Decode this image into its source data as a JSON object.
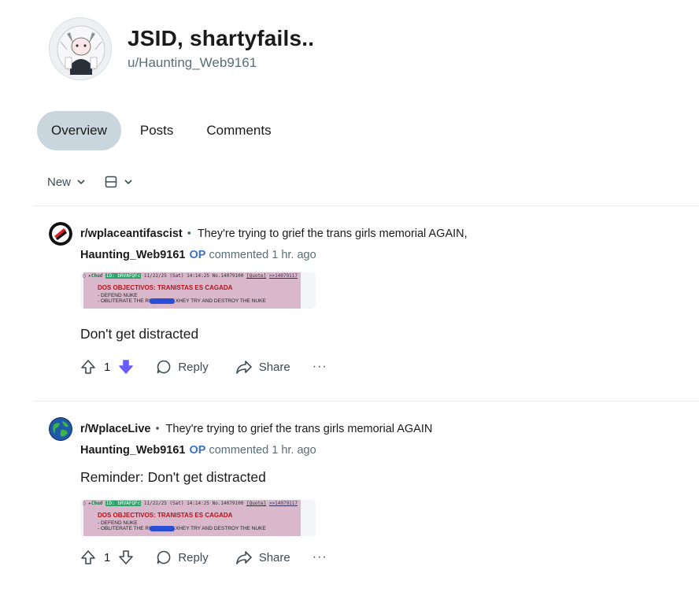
{
  "profile": {
    "display_name": "JSID, shartyfails..",
    "username": "u/Haunting_Web9161"
  },
  "tabs": [
    {
      "label": "Overview",
      "active": true
    },
    {
      "label": "Posts",
      "active": false
    },
    {
      "label": "Comments",
      "active": false
    }
  ],
  "sort": {
    "label": "New"
  },
  "comments": [
    {
      "subreddit": "r/wplaceantifascist",
      "post_title": "They're trying to grief the trans girls memorial AGAIN,",
      "author": "Haunting_Web9161",
      "op_badge": "OP",
      "meta": "commented 1 hr. ago",
      "text": "Don't get distracted",
      "score": "1",
      "reply_label": "Reply",
      "share_label": "Share",
      "more_label": "···",
      "downvoted": true
    },
    {
      "subreddit": "r/WplaceLive",
      "post_title": "They're trying to grief the trans girls memorial AGAIN",
      "author": "Haunting_Web9161",
      "op_badge": "OP",
      "meta": "commented 1 hr. ago",
      "text": "Reminder: Don't get distracted",
      "score": "1",
      "reply_label": "Reply",
      "share_label": "Share",
      "more_label": "···",
      "downvoted": false
    }
  ],
  "image_text": {
    "header_name": "Chud",
    "header_id": "ID: bRVAFQFc",
    "header_date": "11/22/25 (Sat) 14:14:25 No.14079100",
    "header_quote": "[Quote]",
    "header_reply": ">>14079117",
    "line1": "DOS OBJECTIVOS:  TRANISTAS ES CAGADA",
    "line2": "- DEFEND NUKE",
    "line3": "- OBLITERATE THE          RIAL WHILE XHEY TRY AND DESTROY THE NUKE"
  },
  "colors": {
    "tab_active_bg": "#c9d6de",
    "op_blue": "#3b72c4",
    "downvote_purple": "#6a5cff",
    "antifa_red": "#e0202a"
  }
}
